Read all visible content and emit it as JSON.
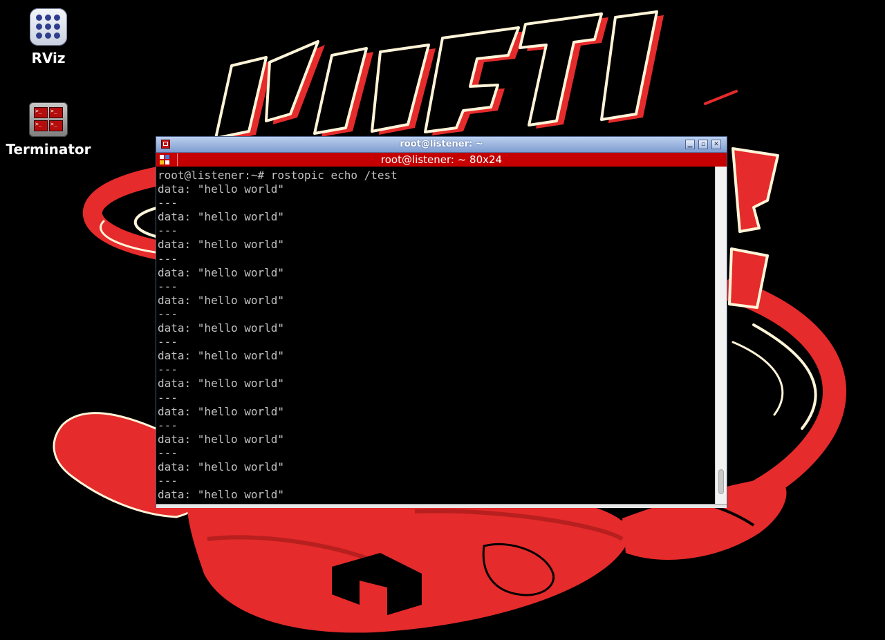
{
  "desktop": {
    "icons": [
      {
        "label": "RViz",
        "icon": "rviz-icon"
      },
      {
        "label": "Terminator",
        "icon": "terminator-icon"
      }
    ],
    "wallpaper_text": "KINETIC",
    "colors": {
      "background": "#000000",
      "accent_red": "#e52b2b",
      "outline_cream": "#fff4d8"
    }
  },
  "terminal_window": {
    "title": "root@listener: ~",
    "tab_title": "root@listener: ~ 80x24",
    "controls": {
      "minimize": "▁",
      "maximize": "▫",
      "close": "✕"
    },
    "lines": [
      "root@listener:~# rostopic echo /test",
      "data: \"hello world\"",
      "---",
      "data: \"hello world\"",
      "---",
      "data: \"hello world\"",
      "---",
      "data: \"hello world\"",
      "---",
      "data: \"hello world\"",
      "---",
      "data: \"hello world\"",
      "---",
      "data: \"hello world\"",
      "---",
      "data: \"hello world\"",
      "---",
      "data: \"hello world\"",
      "---",
      "data: \"hello world\"",
      "---",
      "data: \"hello world\"",
      "---",
      "data: \"hello world\""
    ],
    "colors": {
      "titlebar": "#8fabd9",
      "tabbar": "#c40000",
      "text": "#c2c2c2"
    }
  }
}
